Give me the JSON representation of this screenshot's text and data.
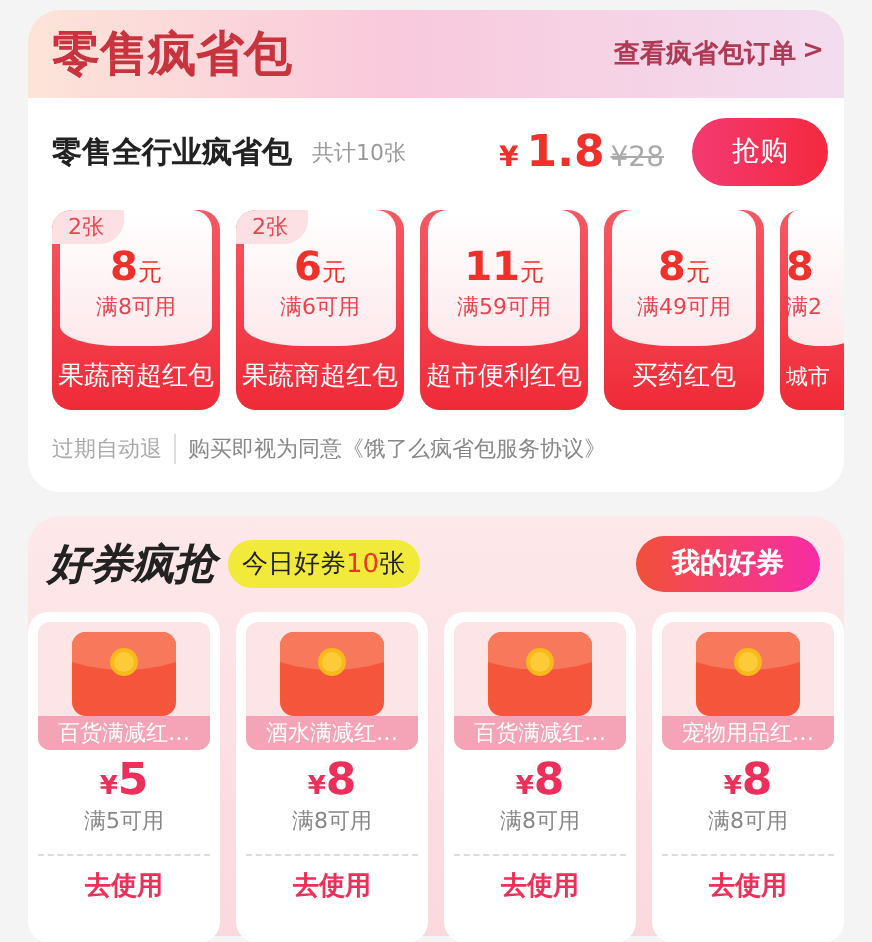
{
  "pack": {
    "title": "零售疯省包",
    "orders_link": "查看疯省包订单",
    "link_arrow": ">",
    "name": "零售全行业疯省包",
    "count": "共计10张",
    "currency": "¥",
    "price": "1.8",
    "original_price": "¥28",
    "buy_button": "抢购",
    "coupons": [
      {
        "badge": "2张",
        "amount": "8",
        "unit": "元",
        "condition": "满8可用",
        "label": "果蔬商超红包"
      },
      {
        "badge": "2张",
        "amount": "6",
        "unit": "元",
        "condition": "满6可用",
        "label": "果蔬商超红包"
      },
      {
        "amount": "11",
        "unit": "元",
        "condition": "满59可用",
        "label": "超市便利红包"
      },
      {
        "amount": "8",
        "unit": "元",
        "condition": "满49可用",
        "label": "买药红包"
      },
      {
        "amount": "8",
        "condition": "满2",
        "label": "城市"
      }
    ],
    "note": "过期自动退",
    "agreement": "购买即视为同意《饿了么疯省包服务协议》"
  },
  "deals": {
    "title": "好券疯抢",
    "today_prefix": "今日好券",
    "today_count": "10",
    "today_suffix": "张",
    "my_button": "我的好券",
    "coupons": [
      {
        "label": "百货满减红…",
        "currency": "¥",
        "amount": "5",
        "condition": "满5可用",
        "action": "去使用"
      },
      {
        "label": "酒水满减红…",
        "currency": "¥",
        "amount": "8",
        "condition": "满8可用",
        "action": "去使用"
      },
      {
        "label": "百货满减红…",
        "currency": "¥",
        "amount": "8",
        "condition": "满8可用",
        "action": "去使用"
      },
      {
        "label": "宠物用品红…",
        "currency": "¥",
        "amount": "8",
        "condition": "满8可用",
        "action": "去使用"
      }
    ]
  }
}
